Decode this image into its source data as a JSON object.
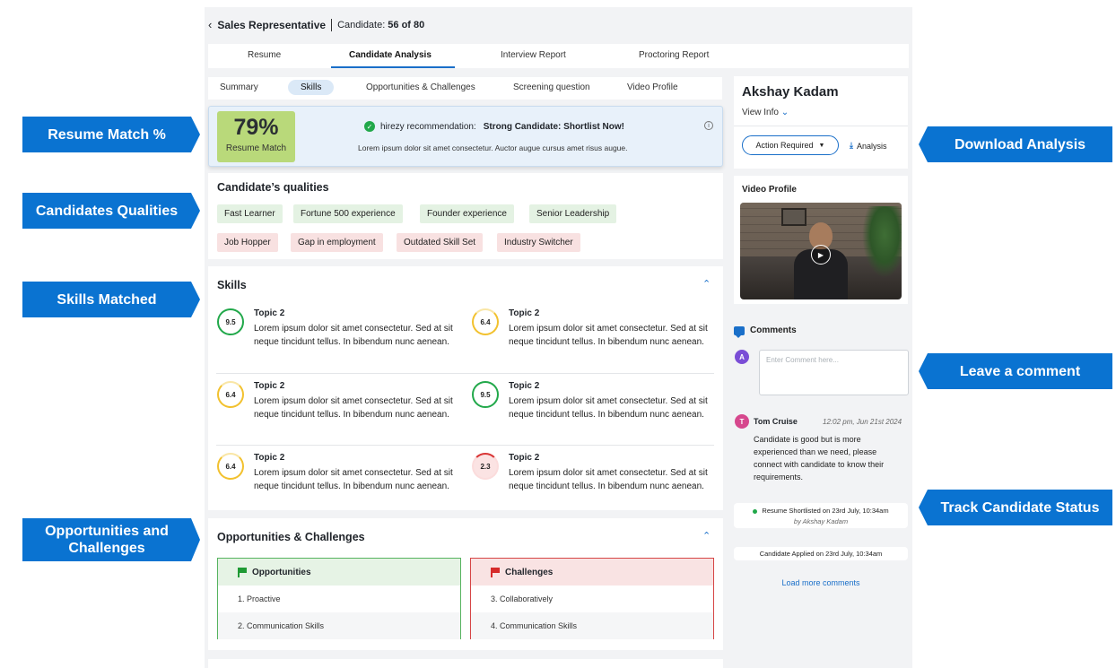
{
  "callouts": {
    "resume_match": "Resume Match %",
    "qualities": "Candidates Qualities",
    "skills": "Skills Matched",
    "opportunities": "Opportunities and Challenges",
    "download": "Download Analysis",
    "comment": "Leave a comment",
    "status": "Track Candidate Status"
  },
  "header": {
    "back_icon": "chevron-left-icon",
    "title": "Sales Representative",
    "candidate_label": "Candidate:",
    "candidate_value": "56 of 80"
  },
  "tabs": [
    "Resume",
    "Candidate Analysis",
    "Interview Report",
    "Proctoring Report"
  ],
  "subtabs": [
    "Summary",
    "Skills",
    "Opportunities & Challenges",
    "Screening question",
    "Video Profile"
  ],
  "recommendation": {
    "match_pct": "79%",
    "match_label": "Resume Match",
    "prefix": "hirezy recommendation:",
    "verdict": "Strong Candidate: Shortlist Now!",
    "detail": "Lorem ipsum dolor sit amet consectetur. Auctor augue cursus amet risus augue."
  },
  "qualities": {
    "title": "Candidate’s qualities",
    "positive": [
      "Fast Learner",
      "Fortune 500 experience",
      "Founder experience",
      "Senior Leadership"
    ],
    "negative": [
      "Job Hopper",
      "Gap in employment",
      "Outdated Skill Set",
      "Industry Switcher"
    ]
  },
  "skills": {
    "title": "Skills",
    "items": [
      {
        "score": "9.5",
        "title": "Topic 2",
        "desc": "Lorem ipsum dolor sit amet consectetur. Sed at sit neque tincidunt tellus. In bibendum nunc aenean."
      },
      {
        "score": "6.4",
        "title": "Topic 2",
        "desc": "Lorem ipsum dolor sit amet consectetur. Sed at sit neque tincidunt tellus. In bibendum nunc aenean."
      },
      {
        "score": "6.4",
        "title": "Topic 2",
        "desc": "Lorem ipsum dolor sit amet consectetur. Sed at sit neque tincidunt tellus. In bibendum nunc aenean."
      },
      {
        "score": "9.5",
        "title": "Topic 2",
        "desc": "Lorem ipsum dolor sit amet consectetur. Sed at sit neque tincidunt tellus. In bibendum nunc aenean."
      },
      {
        "score": "6.4",
        "title": "Topic 2",
        "desc": "Lorem ipsum dolor sit amet consectetur. Sed at sit neque tincidunt tellus. In bibendum nunc aenean."
      },
      {
        "score": "2.3",
        "title": "Topic 2",
        "desc": "Lorem ipsum dolor sit amet consectetur. Sed at sit neque tincidunt tellus. In bibendum nunc aenean."
      }
    ]
  },
  "opps": {
    "title": "Opportunities & Challenges",
    "opportunities_label": "Opportunities",
    "opportunities": [
      "1. Proactive",
      "2. Communication Skills"
    ],
    "challenges_label": "Challenges",
    "challenges": [
      "3. Collaboratively",
      "4. Communication Skills"
    ]
  },
  "profile": {
    "name": "Akshay Kadam",
    "view_info": "View Info",
    "action_label": "Action Required",
    "analysis_label": "Analysis"
  },
  "video": {
    "title": "Video Profile"
  },
  "comments": {
    "title": "Comments",
    "me_initial": "A",
    "placeholder": "Enter Comment here...",
    "author_initial": "T",
    "author": "Tom Cruise",
    "time": "12:02 pm, Jun 21st 2024",
    "text": "Candidate is good but is more experienced than we need, please connect with candidate to know their requirements.",
    "status1": "Resume Shortlisted on 23rd July, 10:34am",
    "status1_by": "by Akshay Kadam",
    "status2": "Candidate Applied on 23rd July, 10:34am",
    "load_more": "Load more comments"
  },
  "colors": {
    "accent": "#1a6fc9",
    "callout": "#0a73d1",
    "match": "#b9d97a",
    "good": "#21a84a",
    "warn": "#f2c12e",
    "bad": "#d93636"
  }
}
